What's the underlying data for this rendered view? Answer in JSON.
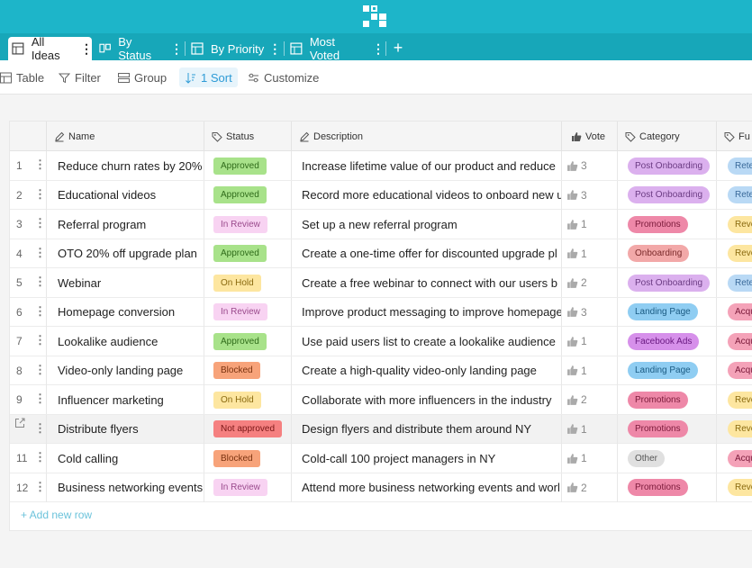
{
  "tabs": [
    {
      "label": "All Ideas",
      "icon": "grid-icon",
      "active": true
    },
    {
      "label": "By Status",
      "icon": "kanban-icon",
      "active": false
    },
    {
      "label": "By Priority",
      "icon": "grid-icon",
      "active": false
    },
    {
      "label": "Most Voted",
      "icon": "grid-icon",
      "active": false
    }
  ],
  "add_tab_label": "+",
  "toolbar": {
    "table": "Table",
    "filter": "Filter",
    "group": "Group",
    "sort": "1 Sort",
    "customize": "Customize"
  },
  "columns": {
    "name": "Name",
    "status": "Status",
    "description": "Description",
    "vote": "Vote",
    "category": "Category",
    "funnel": "Fu"
  },
  "colors": {
    "topbar": "#1db5c9",
    "tabbar": "#17a7b9",
    "accent": "#2d9bd6"
  },
  "status_styles": {
    "Approved": {
      "bg": "#a8e28a",
      "fg": "#2f6b1a"
    },
    "In Review": {
      "bg": "#f8d3f2",
      "fg": "#9a4a8c"
    },
    "On Hold": {
      "bg": "#fde6a0",
      "fg": "#8a6a10"
    },
    "Blocked": {
      "bg": "#f7a37a",
      "fg": "#7a3210"
    },
    "Not approved": {
      "bg": "#f58080",
      "fg": "#7a1616"
    }
  },
  "category_styles": {
    "Post Onboarding": {
      "bg": "#dbb0ee",
      "fg": "#6a3a82"
    },
    "Promotions": {
      "bg": "#ee88a8",
      "fg": "#7a1a3a"
    },
    "Onboarding": {
      "bg": "#f2a8a8",
      "fg": "#7a2a2a"
    },
    "Landing Page": {
      "bg": "#8fcdf2",
      "fg": "#1a5a82"
    },
    "Facebook Ads": {
      "bg": "#d690ea",
      "fg": "#6a1a82"
    },
    "Other": {
      "bg": "#e0e0e0",
      "fg": "#555555"
    }
  },
  "funnel_styles": {
    "Rete": {
      "bg": "#b9d9f5",
      "fg": "#3a6a9a"
    },
    "Reve": {
      "bg": "#fde6a0",
      "fg": "#8a6a10"
    },
    "Acqu": {
      "bg": "#f4a2b8",
      "fg": "#7a1a3a"
    }
  },
  "rows": [
    {
      "num": "1",
      "name": "Reduce churn rates by 20%",
      "status": "Approved",
      "description": "Increase lifetime value of our product and reduce",
      "votes": "3",
      "category": "Post Onboarding",
      "funnel": "Rete"
    },
    {
      "num": "2",
      "name": "Educational videos",
      "status": "Approved",
      "description": "Record more educational videos to onboard new u",
      "votes": "3",
      "category": "Post Onboarding",
      "funnel": "Rete"
    },
    {
      "num": "3",
      "name": "Referral program",
      "status": "In Review",
      "description": "Set up a new referral program",
      "votes": "1",
      "category": "Promotions",
      "funnel": "Reve"
    },
    {
      "num": "4",
      "name": "OTO 20% off upgrade plan",
      "status": "Approved",
      "description": "Create a one-time offer for discounted upgrade pl",
      "votes": "1",
      "category": "Onboarding",
      "funnel": "Reve"
    },
    {
      "num": "5",
      "name": "Webinar",
      "status": "On Hold",
      "description": "Create a free webinar to connect with our users b",
      "votes": "2",
      "category": "Post Onboarding",
      "funnel": "Rete"
    },
    {
      "num": "6",
      "name": "Homepage conversion",
      "status": "In Review",
      "description": "Improve product messaging to improve homepage",
      "votes": "3",
      "category": "Landing Page",
      "funnel": "Acqu"
    },
    {
      "num": "7",
      "name": "Lookalike audience",
      "status": "Approved",
      "description": "Use paid users list to create a lookalike audience",
      "votes": "1",
      "category": "Facebook Ads",
      "funnel": "Acqu"
    },
    {
      "num": "8",
      "name": "Video-only landing page",
      "status": "Blocked",
      "description": "Create a high-quality video-only landing page",
      "votes": "1",
      "category": "Landing Page",
      "funnel": "Acqu"
    },
    {
      "num": "9",
      "name": "Influencer marketing",
      "status": "On Hold",
      "description": "Collaborate with more influencers in the industry",
      "votes": "2",
      "category": "Promotions",
      "funnel": "Reve"
    },
    {
      "num": "",
      "name": "Distribute flyers",
      "status": "Not approved",
      "description": "Design flyers and distribute them around NY",
      "votes": "1",
      "category": "Promotions",
      "funnel": "Reve",
      "highlighted": true
    },
    {
      "num": "11",
      "name": "Cold calling",
      "status": "Blocked",
      "description": "Cold-call 100 project managers in NY",
      "votes": "1",
      "category": "Other",
      "funnel": "Acqu"
    },
    {
      "num": "12",
      "name": "Business networking events",
      "status": "In Review",
      "description": "Attend more business networking events and worl",
      "votes": "2",
      "category": "Promotions",
      "funnel": "Reve"
    }
  ],
  "add_row_label": "+ Add new row"
}
